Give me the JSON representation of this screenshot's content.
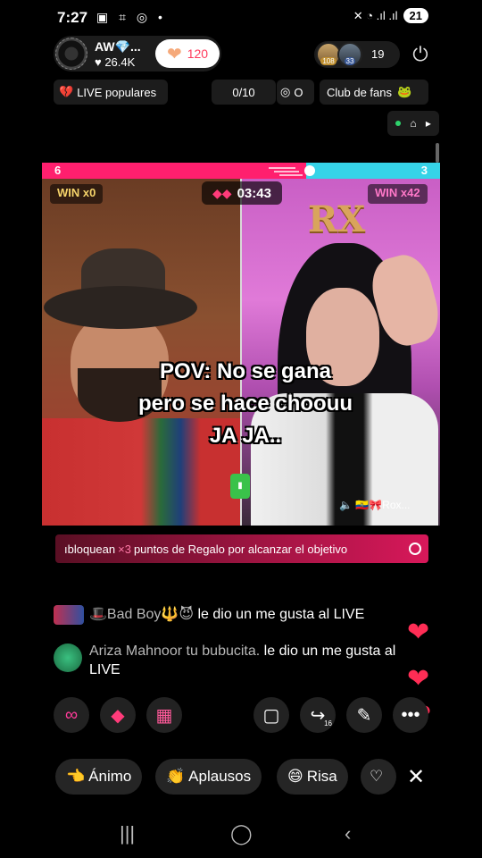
{
  "status_bar": {
    "time": "7:27",
    "left_icons": "▣ ⌗ ◎ •",
    "right_icons": "✕ ◔ .ıl .ıl",
    "battery": "21"
  },
  "host": {
    "name": "AW💎...",
    "likes": "♥ 26.4K",
    "like_count": "120"
  },
  "viewers": {
    "badge1": "108",
    "badge2": "33",
    "count": "19"
  },
  "row2": {
    "popular_label": "LIVE populares",
    "progress": "0/10",
    "goal_label": "O",
    "fans_label": "Club de fans"
  },
  "battle": {
    "left_score": "6",
    "right_score": "3",
    "timer": "03:43",
    "win_left": "WIN x0",
    "win_right": "WIN x42",
    "balloon_text": "RX",
    "caption_lines": [
      "POV: No se gana",
      "pero se hace choouu",
      "JA JA.."
    ],
    "audio_tag": "🔈 🇪🇨🎀Rox..."
  },
  "banner": {
    "prefix": "ıbloquean",
    "multiplier": "×3",
    "suffix": "puntos de Regalo por alcanzar el objetivo"
  },
  "comments": [
    {
      "user": "🎩Bad Boy🔱😈",
      "text": "le dio un me gusta al LIVE"
    },
    {
      "user": "Ariza Mahnoor tu bubucita.",
      "text": "le dio un me gusta al LIVE"
    }
  ],
  "actions": {
    "share_count": "16"
  },
  "reactions": [
    {
      "icon": "👈",
      "label": "Ánimo"
    },
    {
      "icon": "👏",
      "label": "Aplausos"
    },
    {
      "icon": "😄",
      "label": "Risa"
    },
    {
      "icon": "♡",
      "label": ""
    }
  ],
  "colors": {
    "accent_pink": "#ff1f6e",
    "accent_cyan": "#36d3e8",
    "like_red": "#ff2d55"
  }
}
